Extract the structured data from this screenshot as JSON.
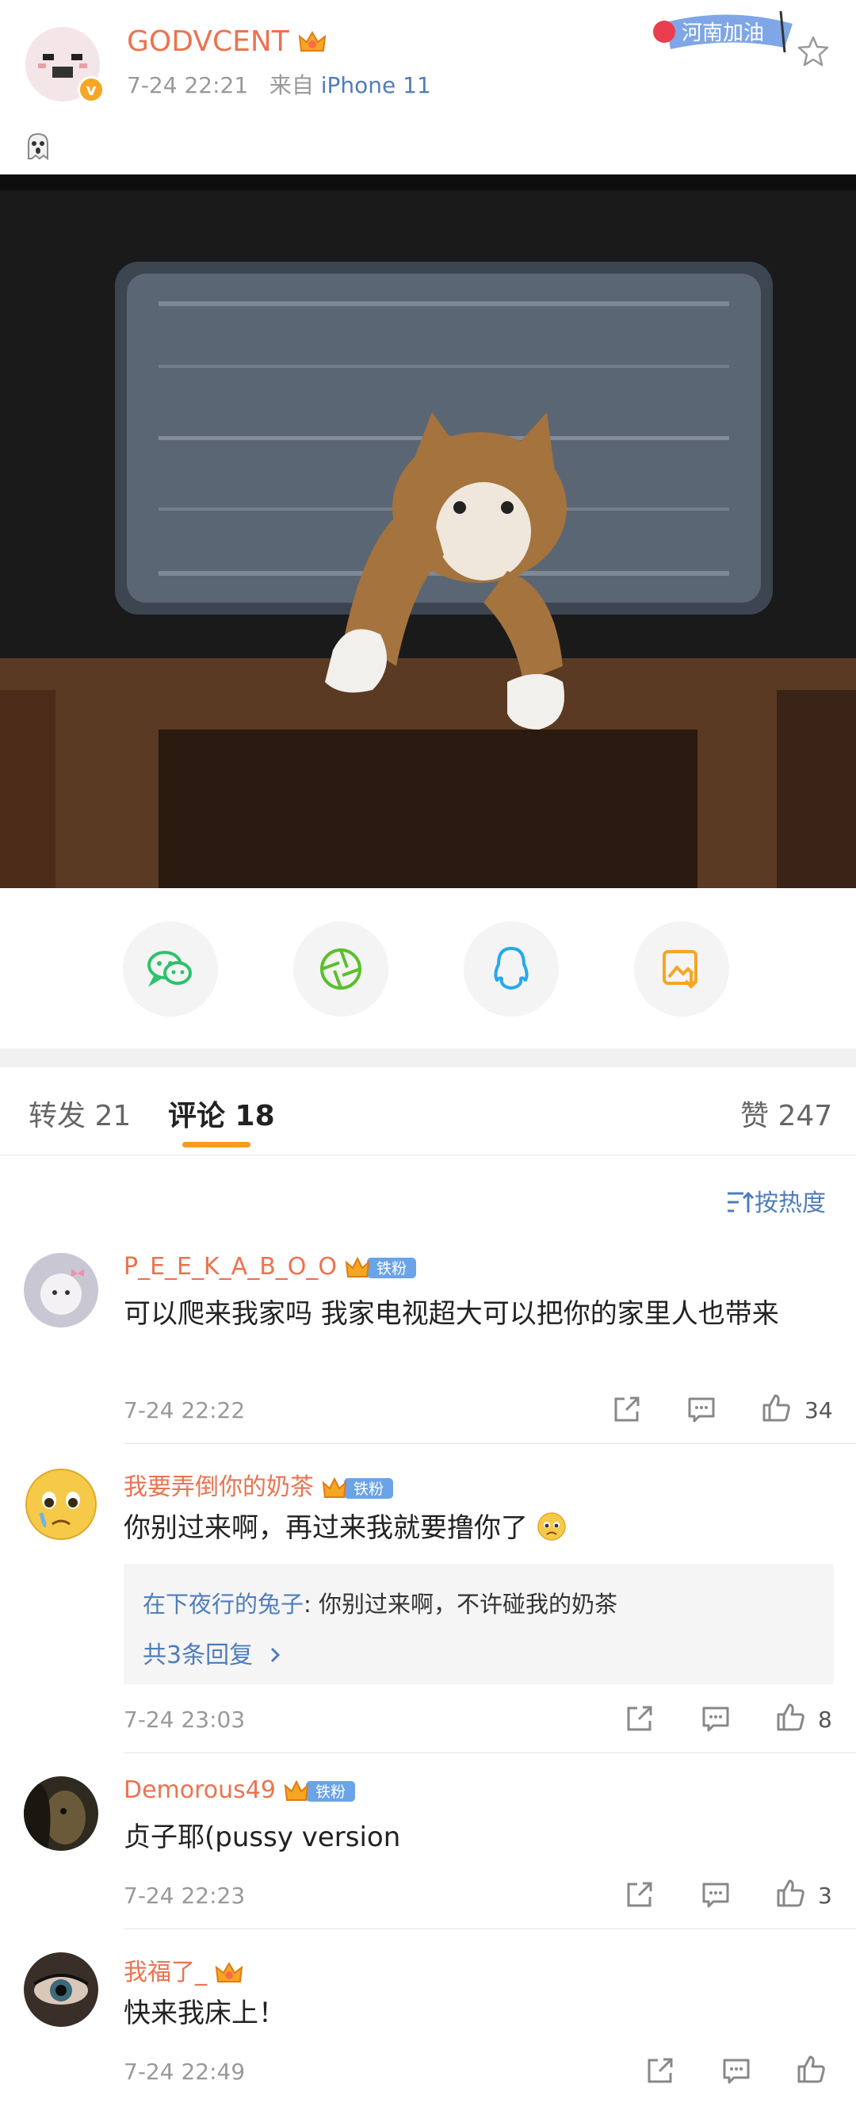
{
  "post": {
    "username": "GODVCENT",
    "time": "7-24 22:21",
    "source_prefix": "来自",
    "device": "iPhone 11",
    "tag_text": "河南加油"
  },
  "tabs": {
    "repost": "转发 21",
    "comments": "评论 18",
    "likes": "赞 247"
  },
  "sort_label": "按热度",
  "comments": [
    {
      "name": "P_E_E_K_A_B_O_O",
      "badge": "铁粉",
      "text": "可以爬来我家吗 我家电视超大可以把你的家里人也带来",
      "time": "7-24 22:22",
      "likes": "34"
    },
    {
      "name": "我要弄倒你的奶茶",
      "badge": "铁粉",
      "text": "你别过来啊，再过来我就要撸你了",
      "time": "7-24 23:03",
      "likes": "8",
      "reply": {
        "name": "在下夜行的兔子",
        "text": ": 你别过来啊，不许碰我的奶茶",
        "more": "共3条回复"
      }
    },
    {
      "name": "Demorous49",
      "badge": "铁粉",
      "text": "贞子耶(pussy version",
      "time": "7-24 22:23",
      "likes": "3"
    },
    {
      "name": "我福了_",
      "text": "快来我床上！",
      "time": "7-24 22:49",
      "likes": ""
    }
  ],
  "colors": {
    "username": "#eb7350",
    "link": "#4f7dba",
    "accent": "#f89a1c"
  }
}
